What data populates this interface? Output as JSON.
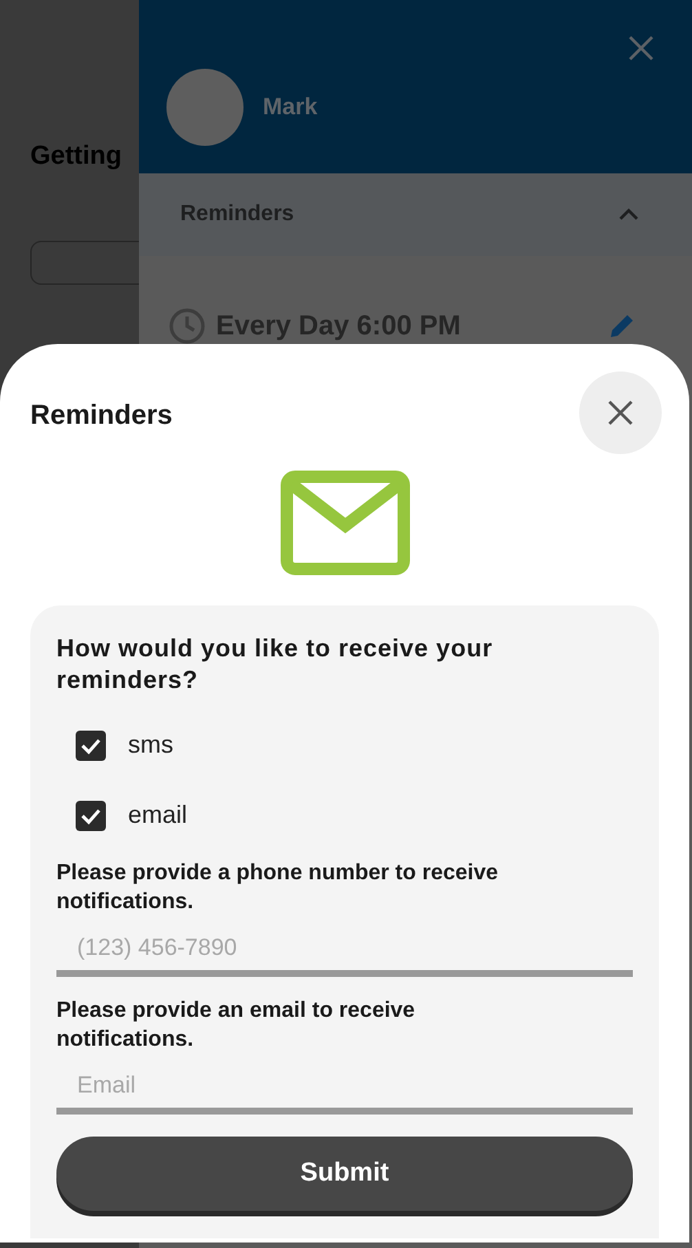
{
  "background_page": {
    "heading": "Getting"
  },
  "drawer": {
    "user_name": "Mark",
    "section": {
      "title": "Reminders",
      "expanded": true
    },
    "reminder": {
      "schedule": "Every Day 6:00 PM"
    }
  },
  "sheet": {
    "title": "Reminders",
    "question": "How would you like to receive your reminders?",
    "options": [
      {
        "label": "sms",
        "checked": true
      },
      {
        "label": "email",
        "checked": true
      }
    ],
    "fields": [
      {
        "label": "Please provide a phone number to receive notifications.",
        "placeholder": "(123) 456-7890"
      },
      {
        "label": "Please provide an email to receive notifications.",
        "placeholder": "Email"
      }
    ],
    "submit": "Submit"
  }
}
